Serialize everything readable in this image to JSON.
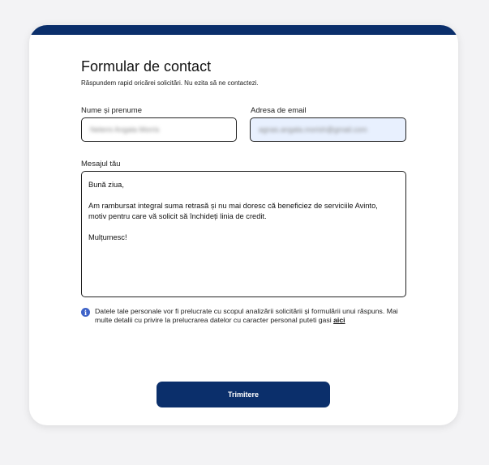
{
  "form": {
    "title": "Formular de contact",
    "subtitle": "Răspundem rapid oricărei solicitări. Nu ezita să ne contactezi.",
    "name_label": "Nume și prenume",
    "name_value": "Nelemi Angala Morris",
    "email_label": "Adresa de email",
    "email_value": "agnas.angala.morish@gmail.com",
    "message_label": "Mesajul tău",
    "message": {
      "line1": "Bună ziua,",
      "line2": "Am rambursat integral suma retrasă și nu mai doresc că beneficiez de serviciile Avinto,",
      "line3": "motiv pentru care vă solicit să închideți linia de credit.",
      "line4": "Mulțumesc!"
    },
    "privacy_text": "Datele tale personale vor fi prelucrate cu scopul analizării solicitării și formulării unui răspuns. Mai multe detalii cu privire la prelucrarea datelor cu caracter personal puteti gasi",
    "privacy_link": "aici",
    "submit_label": "Trimitere"
  },
  "colors": {
    "accent": "#0b2f6b",
    "info_icon": "#3f63c8",
    "email_autofill_bg": "#e8f0fe"
  }
}
